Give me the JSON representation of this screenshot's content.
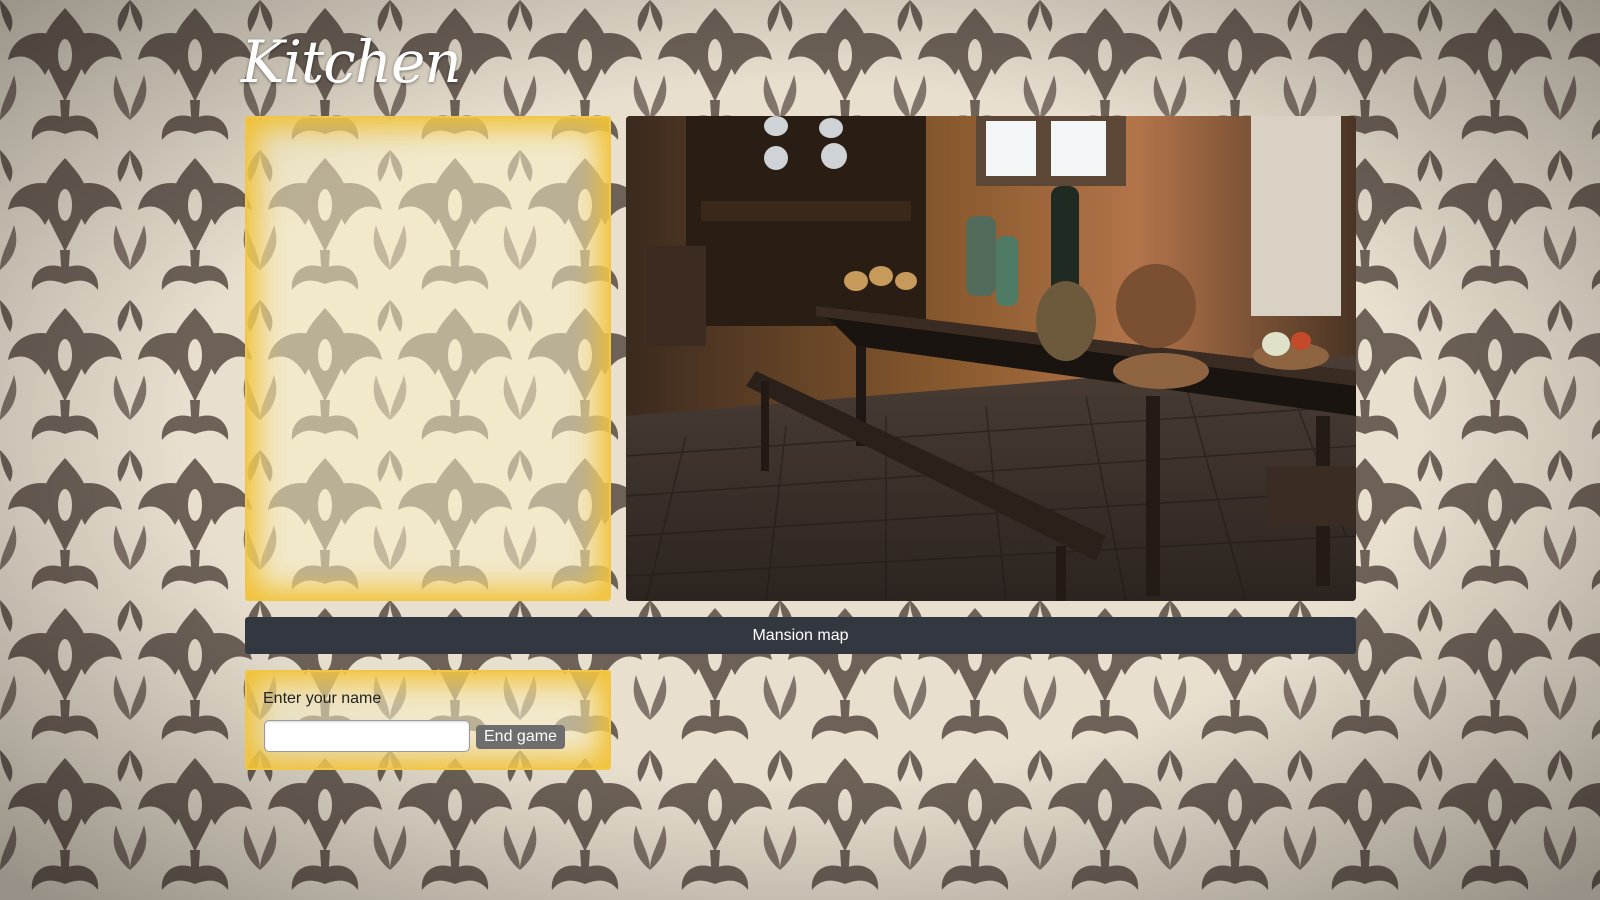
{
  "room": {
    "title": "Kitchen"
  },
  "scene": {
    "image_icon": "kitchen-dining-room-photo"
  },
  "inventory": {
    "items": []
  },
  "navigation": {
    "map_label": "Mansion map"
  },
  "player": {
    "name_label": "Enter your name",
    "name_value": "",
    "end_button_label": "End game"
  },
  "colors": {
    "wallpaper_light": "#e8dfcf",
    "wallpaper_damask": "#6e6258",
    "panel_glow": "#f1c646",
    "map_bar": "#333840",
    "button": "#6e6e6e"
  }
}
